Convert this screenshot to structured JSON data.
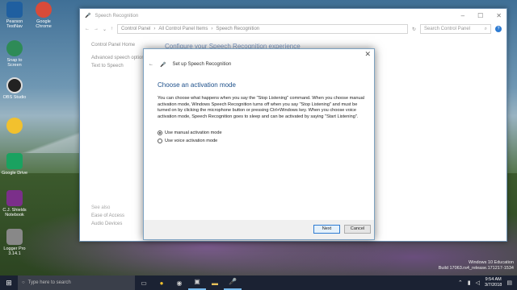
{
  "desktop": {
    "icons": [
      {
        "label": "Pearson TestNav",
        "color": "#1f5fa0",
        "name": "pearson-testnav-icon"
      },
      {
        "label": "Google Chrome",
        "color": "#d84b3a",
        "name": "chrome-icon"
      },
      {
        "label": "Snap to Screen",
        "color": "#2e8b57",
        "name": "snap-icon"
      },
      {
        "label": "OBS Studio",
        "color": "#222",
        "name": "obs-icon"
      },
      {
        "label": "Google Drive",
        "color": "#1aa260",
        "name": "google-drive-icon"
      },
      {
        "label": "C.J. Shields Notebook",
        "color": "#7b2f8a",
        "name": "onenote-icon"
      },
      {
        "label": "Logger Pro 3.14.1",
        "color": "#888",
        "name": "logger-pro-icon"
      }
    ]
  },
  "window": {
    "title": "Speech Recognition",
    "breadcrumb": [
      "Control Panel",
      "All Control Panel Items",
      "Speech Recognition"
    ],
    "search_placeholder": "Search Control Panel",
    "left_links": [
      "Control Panel Home",
      "Advanced speech options",
      "Text to Speech"
    ],
    "heading": "Configure your Speech Recognition experience",
    "see_also_label": "See also",
    "see_also": [
      "Ease of Access",
      "Audio Devices"
    ]
  },
  "dialog": {
    "title": "Set up Speech Recognition",
    "heading": "Choose an activation mode",
    "body": "You can choose what happens when you say the \"Stop Listening\" command. When you choose manual activation mode, Windows Speech Recognition turns off when you say \"Stop Listening\" and must be turned on by clicking the microphone button or pressing Ctrl+Windows key. When you choose voice activation mode, Speech Recognition goes to sleep and can be activated by saying \"Start Listening\".",
    "option_manual": "Use manual activation mode",
    "option_voice": "Use voice activation mode",
    "selected": "manual",
    "next_label": "Next",
    "cancel_label": "Cancel"
  },
  "watermark": {
    "line1": "Windows 10 Education",
    "line2": "Build 17063.rs4_release.171217-1534"
  },
  "taskbar": {
    "search_placeholder": "Type here to search",
    "time": "9:54 AM",
    "date": "3/7/2018"
  }
}
